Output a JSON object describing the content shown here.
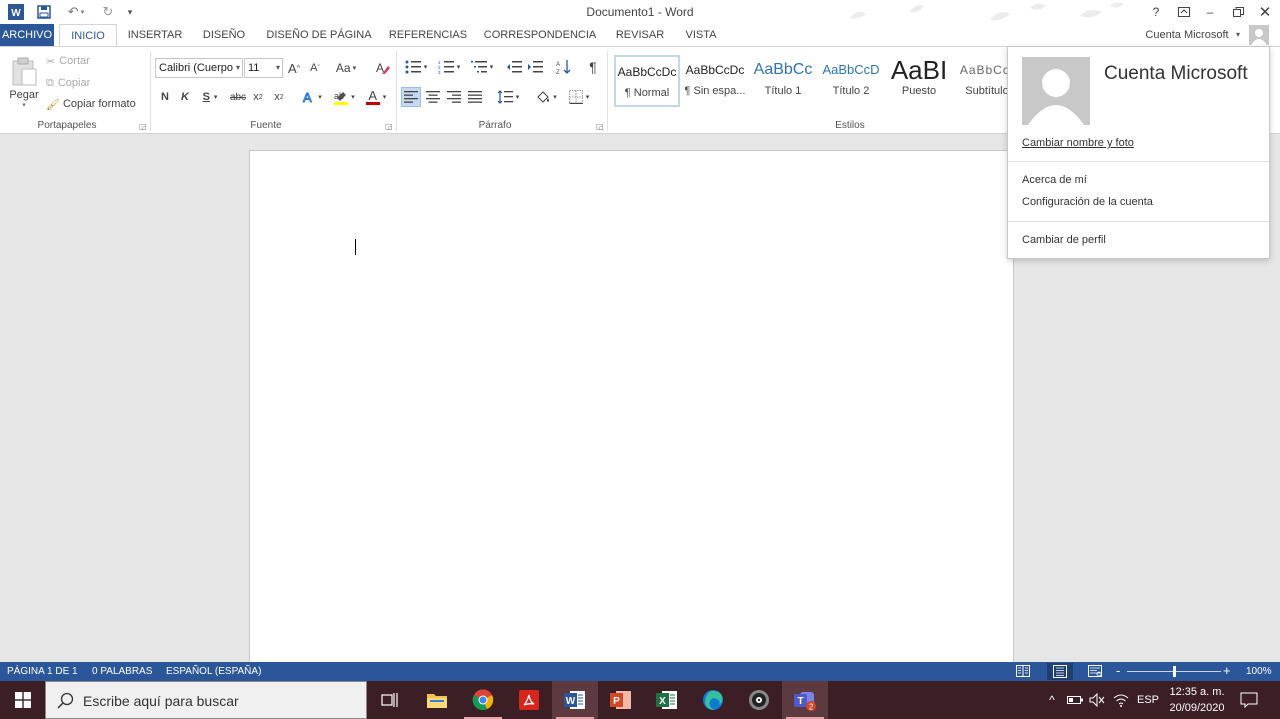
{
  "window": {
    "title": "Documento1 - Word",
    "help": "?",
    "account_label": "Cuenta Microsoft"
  },
  "tabs": [
    {
      "label": "ARCHIVO"
    },
    {
      "label": "INICIO"
    },
    {
      "label": "INSERTAR"
    },
    {
      "label": "DISEÑO"
    },
    {
      "label": "DISEÑO DE PÁGINA"
    },
    {
      "label": "REFERENCIAS"
    },
    {
      "label": "CORRESPONDENCIA"
    },
    {
      "label": "REVISAR"
    },
    {
      "label": "VISTA"
    }
  ],
  "ribbon": {
    "clipboard": {
      "paste": "Pegar",
      "cut": "Cortar",
      "copy": "Copiar",
      "format_painter": "Copiar formato",
      "group_label": "Portapapeles"
    },
    "font": {
      "font_name": "Calibri (Cuerpo",
      "font_size": "11",
      "grow": "A",
      "shrink": "A",
      "case": "Aa",
      "bold": "N",
      "italic": "K",
      "underline": "S",
      "strike": "abc",
      "subscript": "x",
      "subscript_mark": "2",
      "superscript": "x",
      "superscript_mark": "2",
      "font_color": "A",
      "group_label": "Fuente"
    },
    "paragraph": {
      "show_marks": "¶",
      "group_label": "Párrafo"
    },
    "styles": {
      "items": [
        {
          "sample": "AaBbCcDc",
          "name": "¶ Normal"
        },
        {
          "sample": "AaBbCcDc",
          "name": "¶ Sin espa..."
        },
        {
          "sample": "AaBbCc",
          "name": "Título 1"
        },
        {
          "sample": "AaBbCcD",
          "name": "Título 2"
        },
        {
          "sample": "AaBI",
          "name": "Puesto"
        },
        {
          "sample": "AaBbCcI",
          "name": "Subtítulo"
        }
      ],
      "group_label": "Estilos"
    }
  },
  "account_panel": {
    "name": "Cuenta Microsoft",
    "change_name_photo": "Cambiar nombre y foto",
    "about_me": "Acerca de mí",
    "account_settings": "Configuración de la cuenta",
    "switch_profile": "Cambiar de perfil"
  },
  "status": {
    "page": "PÁGINA 1 DE 1",
    "words": "0 PALABRAS",
    "language": "ESPAÑOL (ESPAÑA)",
    "zoom_minus": "-",
    "zoom_plus": "+",
    "zoom": "100%",
    "zoom_level": 0.5
  },
  "taskbar": {
    "search_placeholder": "Escribe aquí para buscar",
    "language": "ESP",
    "time": "12:35 a. m.",
    "date": "20/09/2020",
    "teams_badge": "2"
  },
  "colors": {
    "word_blue": "#2b579a",
    "taskbar": "#3b1f24",
    "taskbar_search": "#f0f0f0"
  }
}
